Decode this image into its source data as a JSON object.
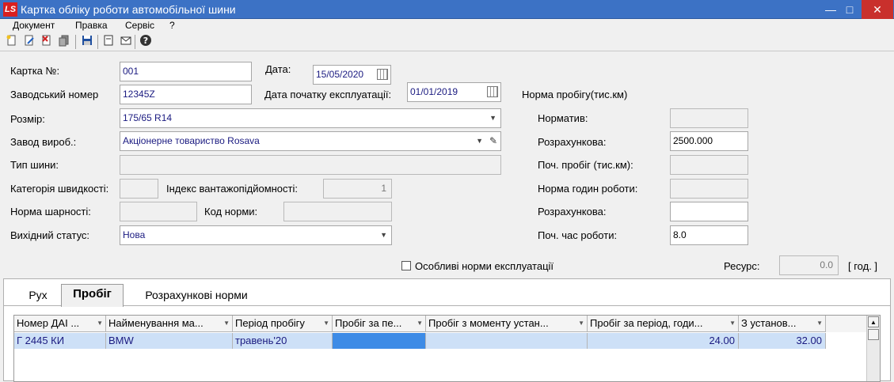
{
  "window": {
    "title": "Картка обліку роботи автомобільної шини",
    "logo": "LS",
    "minimize": "—",
    "maximize": "□",
    "close": "✕"
  },
  "menu": [
    "Документ",
    "Правка",
    "Сервіс",
    "?"
  ],
  "toolbar": {
    "icons": [
      "new-doc-icon",
      "edit-doc-icon",
      "delete-doc-icon",
      "copy-doc-icon",
      "save-icon",
      "print-icon",
      "mail-icon",
      "help-icon"
    ]
  },
  "form": {
    "card_no_label": "Картка №:",
    "card_no_value": "001",
    "date_label": "Дата:",
    "date_value": "15/05/2020",
    "serial_label": "Заводський номер",
    "serial_value": "12345Z",
    "start_date_label": "Дата початку експлуатації:",
    "start_date_value": "01/01/2019",
    "size_label": "Розмір:",
    "size_value": "175/65 R14",
    "maker_label": "Завод вироб.:",
    "maker_value": "Акціонерне товариство Rosava",
    "tire_type_label": "Тип шини:",
    "tire_type_value": "",
    "speed_cat_label": "Категорія швидкості:",
    "speed_cat_value": "",
    "load_index_label": "Індекс вантажопідйомності:",
    "load_index_value": "1",
    "tread_norm_label": "Норма шарності:",
    "tread_norm_value": "",
    "norm_code_label": "Код норми:",
    "norm_code_value": "",
    "status_label": "Вихідний статус:",
    "status_value": "Нова",
    "special_norms_label": "Особливі норми експлуатації",
    "resource_label": "Ресурс:",
    "resource_value": "0.0",
    "resource_unit": "[ год. ]"
  },
  "norms": {
    "heading": "Норма пробігу(тис.км)",
    "normative_label": "Норматив:",
    "normative_value": "",
    "calc_label": "Розрахункова:",
    "calc_value": "2500.000",
    "start_mileage_label": "Поч. пробіг (тис.км):",
    "start_mileage_value": "",
    "hours_norm_label": "Норма годин роботи:",
    "hours_norm_value": "",
    "calc2_label": "Розрахункова:",
    "calc2_value": "",
    "start_hours_label": "Поч. час роботи:",
    "start_hours_value": "8.0"
  },
  "tabs": [
    "Рух",
    "Пробіг",
    "Розрахункові норми"
  ],
  "grid": {
    "columns": [
      "Номер ДАІ ...",
      "Найменування ма...",
      "Період пробігу",
      "Пробіг за пе...",
      "Пробіг з моменту устан...",
      "Пробіг за період, годи...",
      "З установ..."
    ],
    "rows": [
      [
        "Г 2445 КИ",
        "BMW",
        "травень'20",
        "",
        "",
        "24.00",
        "32.00"
      ]
    ]
  }
}
